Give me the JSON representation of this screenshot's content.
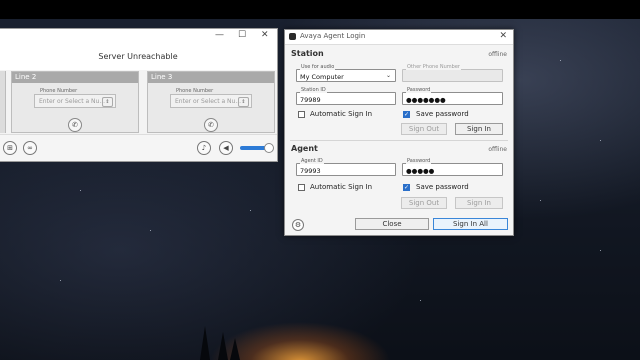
{
  "softphone": {
    "status": "Server Unreachable",
    "lines": [
      {
        "label": "Line 2",
        "phone_label": "Phone Number",
        "placeholder": "Enter or Select a Nu..."
      },
      {
        "label": "Line 3",
        "phone_label": "Phone Number",
        "placeholder": "Enter or Select a Nu..."
      }
    ],
    "volume_level": 0.85
  },
  "agent_window": {
    "title": "Avaya Agent Login",
    "station": {
      "heading": "Station",
      "status": "offline",
      "use_for_audio_label": "Use for audio",
      "use_for_audio_value": "My Computer",
      "other_phone_label": "Other Phone Number",
      "station_id_label": "Station ID",
      "station_id_value": "79989",
      "password_label": "Password",
      "password_value": "●●●●●●●",
      "auto_sign_in_label": "Automatic Sign In",
      "auto_sign_in_checked": false,
      "save_password_label": "Save password",
      "save_password_checked": true,
      "sign_out": "Sign Out",
      "sign_in": "Sign In"
    },
    "agent": {
      "heading": "Agent",
      "status": "offline",
      "agent_id_label": "Agent ID",
      "agent_id_value": "79993",
      "password_label": "Password",
      "password_value": "●●●●●",
      "auto_sign_in_label": "Automatic Sign In",
      "auto_sign_in_checked": false,
      "save_password_label": "Save password",
      "save_password_checked": true,
      "sign_out": "Sign Out",
      "sign_in": "Sign In"
    },
    "footer": {
      "close": "Close",
      "sign_in_all": "Sign In All"
    }
  },
  "colors": {
    "highlight": "#fbf31a",
    "accent": "#2a6fc9"
  }
}
